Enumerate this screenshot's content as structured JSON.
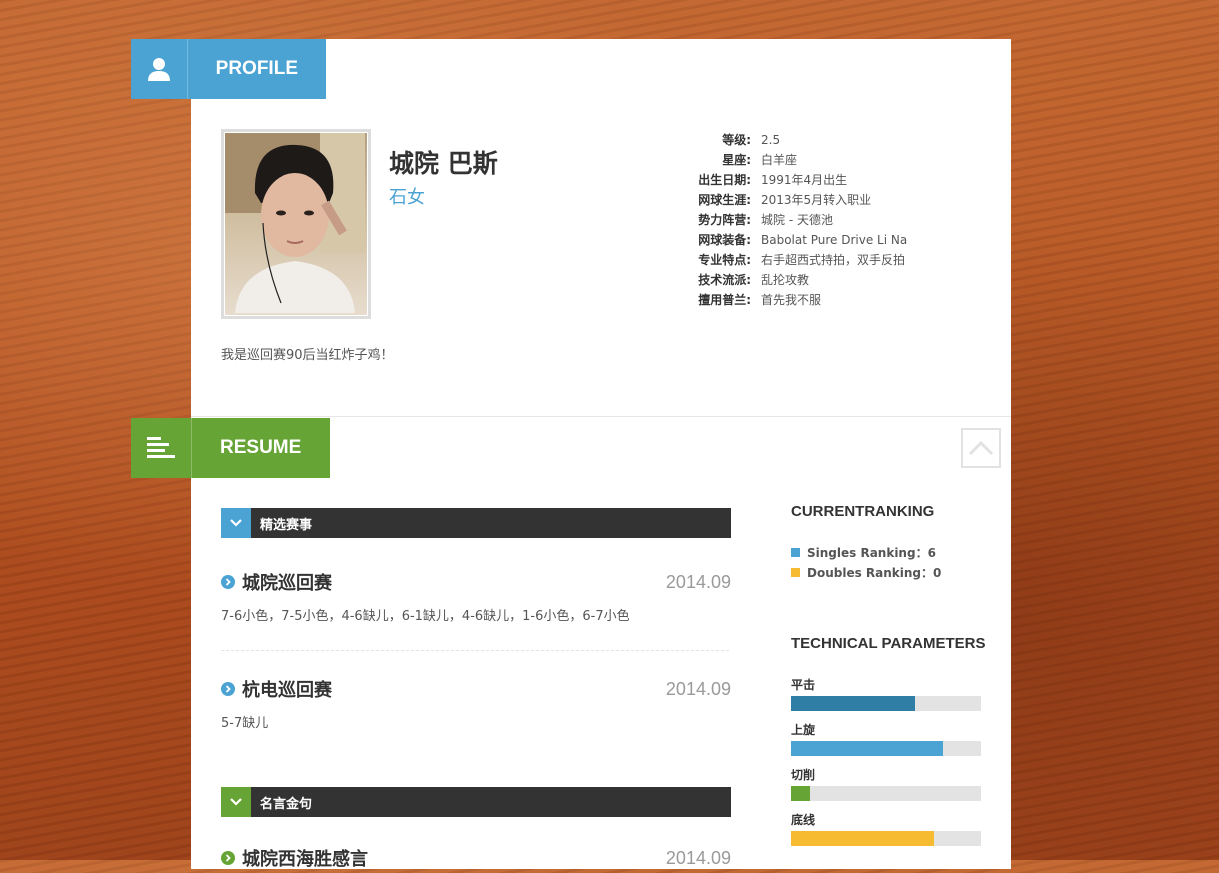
{
  "profile": {
    "tab_label": "PROFILE",
    "name": "城院 巴斯",
    "subtitle": "石女",
    "bio": "我是巡回赛90后当红炸子鸡！",
    "info": [
      {
        "key": "等级:",
        "value": "2.5"
      },
      {
        "key": "星座:",
        "value": "白羊座"
      },
      {
        "key": "出生日期:",
        "value": "1991年4月出生"
      },
      {
        "key": "网球生涯:",
        "value": "2013年5月转入职业"
      },
      {
        "key": "势力阵营:",
        "value": "城院 - 天德池"
      },
      {
        "key": "网球装备:",
        "value": "Babolat Pure Drive Li Na"
      },
      {
        "key": "专业特点:",
        "value": "右手超西式持拍，双手反拍"
      },
      {
        "key": "技术流派:",
        "value": "乱抡攻教"
      },
      {
        "key": "擅用普兰:",
        "value": "首先我不服"
      }
    ]
  },
  "resume": {
    "tab_label": "RESUME",
    "category1": "精选赛事",
    "category2": "名言金句",
    "events": [
      {
        "title": "城院巡回赛",
        "date": "2014.09",
        "score": "7-6小色，7-5小色，4-6缺儿，6-1缺儿，4-6缺儿，1-6小色，6-7小色"
      },
      {
        "title": "杭电巡回赛",
        "date": "2014.09",
        "score": "5-7缺儿"
      },
      {
        "title": "城院西海胜感言",
        "date": "2014.09"
      }
    ]
  },
  "sidebar": {
    "ranking_heading": "CURRENTRANKING",
    "singles": "Singles Ranking：6",
    "doubles": "Doubles Ranking：0",
    "params_heading": "TECHNICAL PARAMETERS",
    "params": [
      {
        "label": "平击",
        "level": 0.65,
        "color": "#2e7ea6"
      },
      {
        "label": "上旋",
        "level": 0.8,
        "color": "#4ba3d3"
      },
      {
        "label": "切削",
        "level": 0.1,
        "color": "#67a436"
      },
      {
        "label": "底线",
        "level": 0.75,
        "color": "#f6bb31"
      }
    ]
  },
  "colors": {
    "profile_accent": "#4ba3d3",
    "resume_accent": "#67a436",
    "singles_color": "#4ba3d3",
    "doubles_color": "#f6bb31"
  },
  "icons": {
    "profile": "user-icon",
    "resume": "list-icon",
    "back_to_top": "chevron-up-icon",
    "category": "chevron-down-icon",
    "event_bullet": "chevron-right-icon"
  }
}
